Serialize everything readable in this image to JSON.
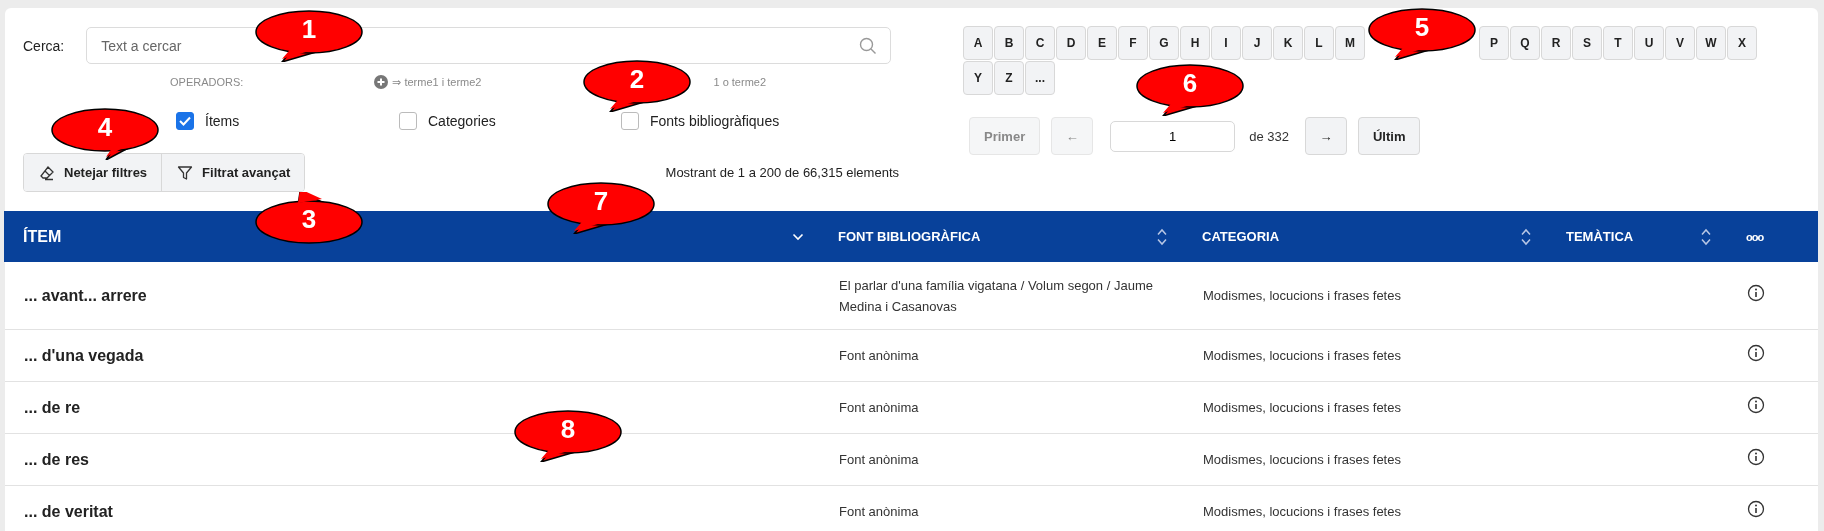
{
  "search": {
    "label": "Cerca:",
    "placeholder": "Text a cercar"
  },
  "operators": {
    "label": "OPERADORS:",
    "and_text": "⇒ terme1 i terme2",
    "or_text": "1 o terme2"
  },
  "scopes": [
    {
      "label": "Ítems",
      "checked": true
    },
    {
      "label": "Categories",
      "checked": false
    },
    {
      "label": "Fonts bibliogràfiques",
      "checked": false
    }
  ],
  "actions": [
    {
      "label": "Netejar filtres",
      "kind": "clear"
    },
    {
      "label": "Filtrat avançat",
      "kind": "filter"
    }
  ],
  "result_count": "Mostrant de 1 a 200 de 66,315 elements",
  "letters": [
    {
      "label": "A"
    },
    {
      "label": "B"
    },
    {
      "label": "C"
    },
    {
      "label": "D"
    },
    {
      "label": "E"
    },
    {
      "label": "F"
    },
    {
      "label": "G"
    },
    {
      "label": "H"
    },
    {
      "label": "I"
    },
    {
      "label": "J"
    },
    {
      "label": "K"
    },
    {
      "label": "L"
    },
    {
      "label": "M"
    },
    {
      "label": "P"
    },
    {
      "label": "Q"
    },
    {
      "label": "R"
    },
    {
      "label": "S"
    },
    {
      "label": "T"
    },
    {
      "label": "U"
    },
    {
      "label": "V"
    },
    {
      "label": "W"
    },
    {
      "label": "X"
    },
    {
      "label": "Y"
    },
    {
      "label": "Z"
    },
    {
      "label": "..."
    }
  ],
  "pagination": {
    "first": "Primer",
    "first_disabled": true,
    "prev": "←",
    "prev_disabled": true,
    "page": "1",
    "of": "de 332",
    "next": "→",
    "last": "Últim"
  },
  "table": {
    "columns": [
      {
        "label": "ÍTEM",
        "kind": "sorted"
      },
      {
        "label": "FONT BIBLIOGRÀFICA",
        "kind": "sortable"
      },
      {
        "label": "CATEGORIA",
        "kind": "sortable"
      },
      {
        "label": "TEMÀTICA",
        "kind": "sortable"
      },
      {
        "label": "ooo",
        "kind": "menu"
      }
    ],
    "rows": [
      {
        "item": "... avant... arrere",
        "source": "El parlar d'una família vigatana / Volum segon / Jaume Medina i Casanovas",
        "category": "Modismes, locucions i frases fetes"
      },
      {
        "item": "... d'una vegada",
        "source": "Font anònima",
        "category": "Modismes, locucions i frases fetes"
      },
      {
        "item": "... de re",
        "source": "Font anònima",
        "category": "Modismes, locucions i frases fetes"
      },
      {
        "item": "... de res",
        "source": "Font anònima",
        "category": "Modismes, locucions i frases fetes"
      },
      {
        "item": "... de veritat",
        "source": "Font anònima",
        "category": "Modismes, locucions i frases fetes"
      }
    ]
  },
  "callouts": [
    {
      "label": "1"
    },
    {
      "label": "2"
    },
    {
      "label": "3"
    },
    {
      "label": "4"
    },
    {
      "label": "5"
    },
    {
      "label": "6"
    },
    {
      "label": "7"
    },
    {
      "label": "8"
    }
  ]
}
